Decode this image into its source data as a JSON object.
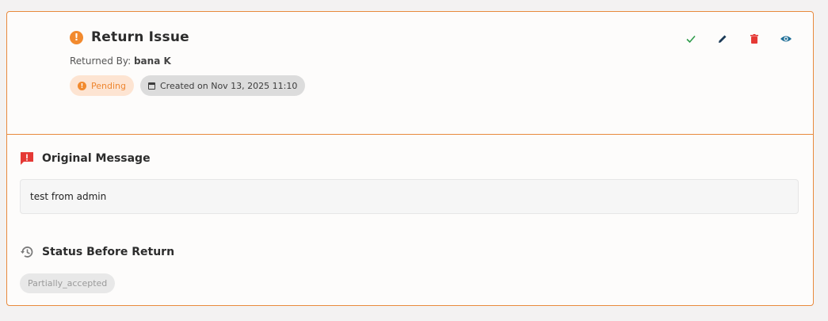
{
  "header": {
    "title": "Return Issue",
    "returned_by_label": "Returned By:",
    "returned_by_name": "bana K",
    "status_chip": "Pending",
    "created_chip": "Created on Nov 13, 2025 11:10"
  },
  "actions": {
    "icons": [
      "check-icon",
      "edit-icon",
      "delete-icon",
      "view-icon"
    ],
    "colors": {
      "check": "#2e9b4a",
      "edit": "#1b3a57",
      "delete": "#e53935",
      "view": "#1e6f98"
    }
  },
  "original_message": {
    "title": "Original Message",
    "text": "test from admin"
  },
  "status_before_return": {
    "title": "Status Before Return",
    "value": "Partially_accepted"
  },
  "colors": {
    "accent": "#e88a3d",
    "pending_bg": "#fde4d2",
    "pending_text": "#ee8630"
  }
}
